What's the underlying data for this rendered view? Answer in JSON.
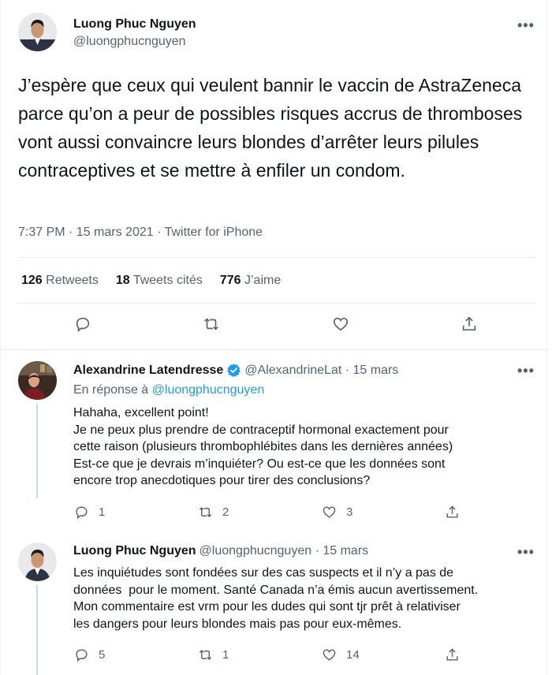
{
  "main_tweet": {
    "author_name": "Luong Phuc Nguyen",
    "author_handle": "@luongphucnguyen",
    "text": "J’espère que ceux qui veulent bannir le vaccin de AstraZeneca parce qu’on a peur de possibles risques accrus de thromboses vont aussi convaincre leurs blondes d’arrêter leurs pilules contraceptives et se mettre à enfiler un condom.",
    "meta": "7:37 PM · 15 mars 2021 · Twitter for iPhone",
    "stats": [
      {
        "count": "126",
        "label": "Retweets"
      },
      {
        "count": "18",
        "label": "Tweets cités"
      },
      {
        "count": "776",
        "label": "J’aime"
      }
    ]
  },
  "replies": [
    {
      "author_name": "Alexandrine Latendresse",
      "verified": true,
      "handle_time": "@AlexandrineLat · 15 mars",
      "reply_to_prefix": "En réponse à",
      "reply_to_handle": "@luongphucnguyen",
      "lines": [
        "Hahaha, excellent point!",
        "Je ne peux plus prendre de contraceptif hormonal exactement pour",
        "cette raison (plusieurs thrombophlébites dans les dernières années)",
        "Est-ce que je devrais m’inquiéter? Ou est-ce que les données sont",
        "encore trop anecdotiques pour tirer des conclusions?"
      ],
      "replies_count": "1",
      "retweets_count": "2",
      "likes_count": "3"
    },
    {
      "author_name": "Luong Phuc Nguyen",
      "handle_time": "@luongphucnguyen · 15 mars",
      "lines": [
        "Les inquiétudes sont fondées sur des cas suspects et il n’y a pas de",
        "données  pour le moment. Santé Canada n’a émis aucun avertissement.",
        "Mon commentaire est vrm pour les dudes qui sont tjr prêt à relativiser",
        "les dangers pour leurs blondes mais pas pour eux-mêmes."
      ],
      "replies_count": "5",
      "retweets_count": "1",
      "likes_count": "14"
    }
  ],
  "more_label": "•••",
  "colors": {
    "accent": "#1d9bf0",
    "secondary_text": "#536471",
    "primary_text": "#0f1419",
    "verified": "#1d9bf0"
  },
  "icons": [
    "reply-icon",
    "retweet-icon",
    "like-icon",
    "share-icon",
    "more-icon",
    "verified-icon"
  ]
}
